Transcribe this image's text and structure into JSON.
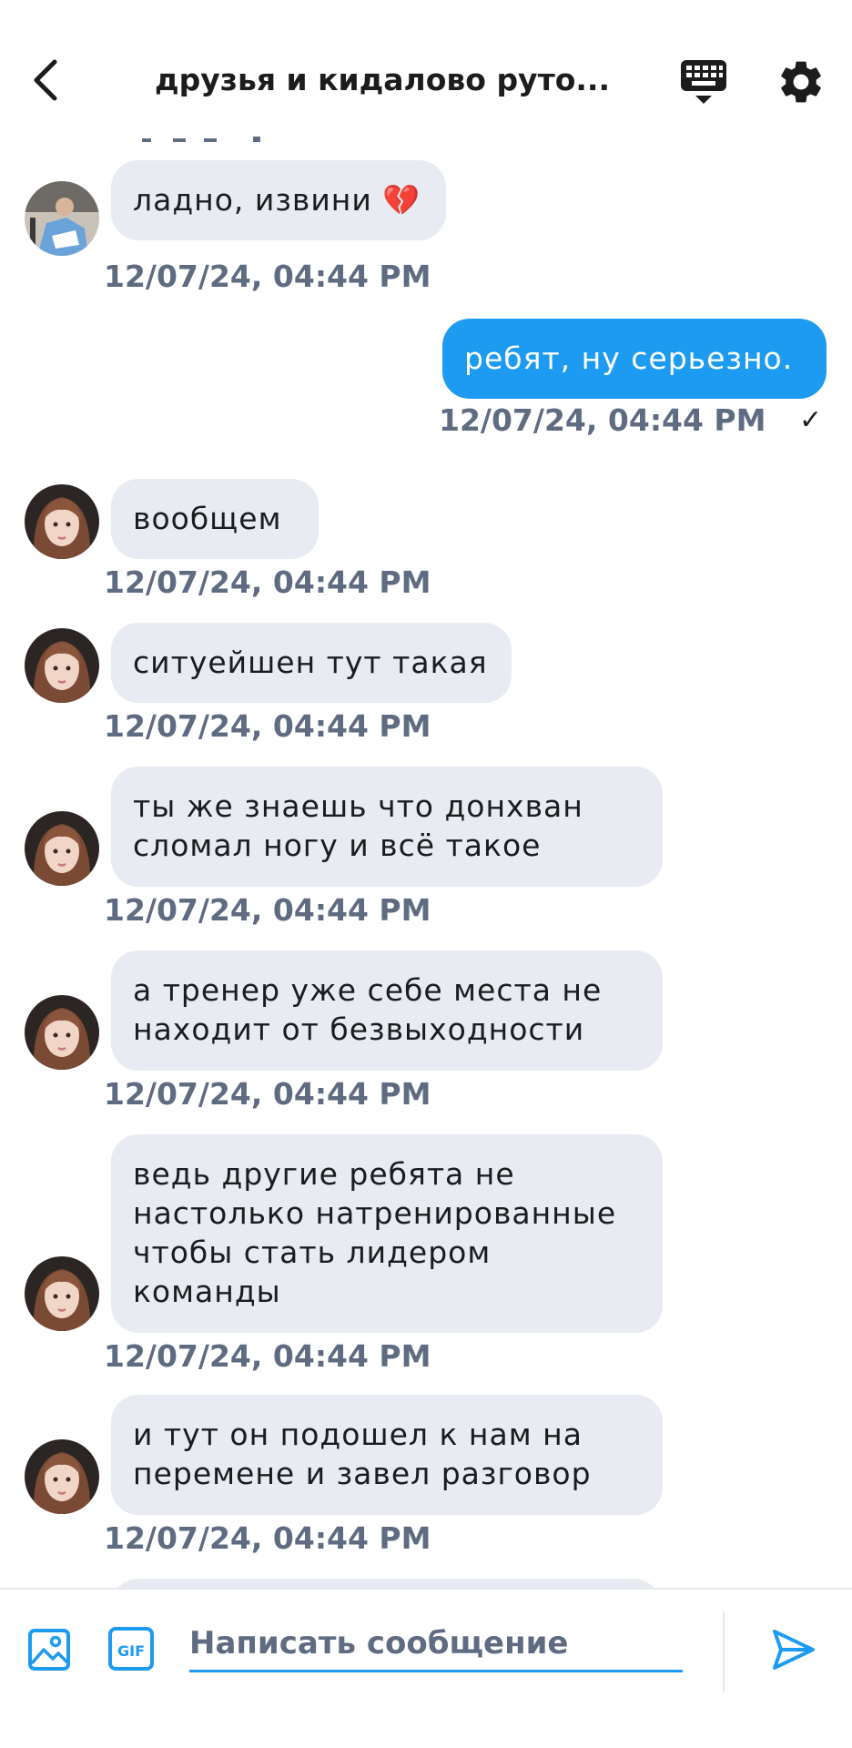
{
  "header": {
    "title": "друзья и кидалово руто...",
    "back_icon": "chevron-left-icon",
    "keyboard_icon": "keyboard-icon",
    "settings_icon": "gear-icon"
  },
  "messages": [
    {
      "direction": "in",
      "avatar": "avatar-photo-1",
      "text": "ладно, извини 💔",
      "time": "12/07/24, 04:44 PM"
    },
    {
      "direction": "out",
      "text": "ребят, ну серьезно.",
      "time": "12/07/24, 04:44 PM",
      "read_icon": "✓"
    },
    {
      "direction": "in",
      "avatar": "avatar-photo-2",
      "text": "вообщем",
      "time": "12/07/24, 04:44 PM"
    },
    {
      "direction": "in",
      "avatar": "avatar-photo-2",
      "text": "ситуейшен тут такая",
      "time": "12/07/24, 04:44 PM"
    },
    {
      "direction": "in",
      "avatar": "avatar-photo-2",
      "text": "ты же знаешь что донхван\nсломал ногу и всё такое",
      "time": "12/07/24, 04:44 PM"
    },
    {
      "direction": "in",
      "avatar": "avatar-photo-2",
      "text": "а тренер уже себе места не\nнаходит от безвыходности",
      "time": "12/07/24, 04:44 PM"
    },
    {
      "direction": "in",
      "avatar": "avatar-photo-2",
      "text": "ведь другие ребята не\nнастолько натренированные\nчтобы стать лидером\nкоманды",
      "time": "12/07/24, 04:44 PM"
    },
    {
      "direction": "in",
      "avatar": "avatar-photo-2",
      "text": "и тут он подошел к нам на\nперемене и завел разговор",
      "time": "12/07/24, 04:44 PM"
    }
  ],
  "composer": {
    "placeholder": "Написать сообщение",
    "image_icon": "image-icon",
    "gif_label": "GIF",
    "send_icon": "send-icon"
  },
  "colors": {
    "accent": "#1d9bf0",
    "incoming_bubble": "#e8ebf2",
    "timestamp": "#5f6b80",
    "text": "#1c1c1e"
  }
}
